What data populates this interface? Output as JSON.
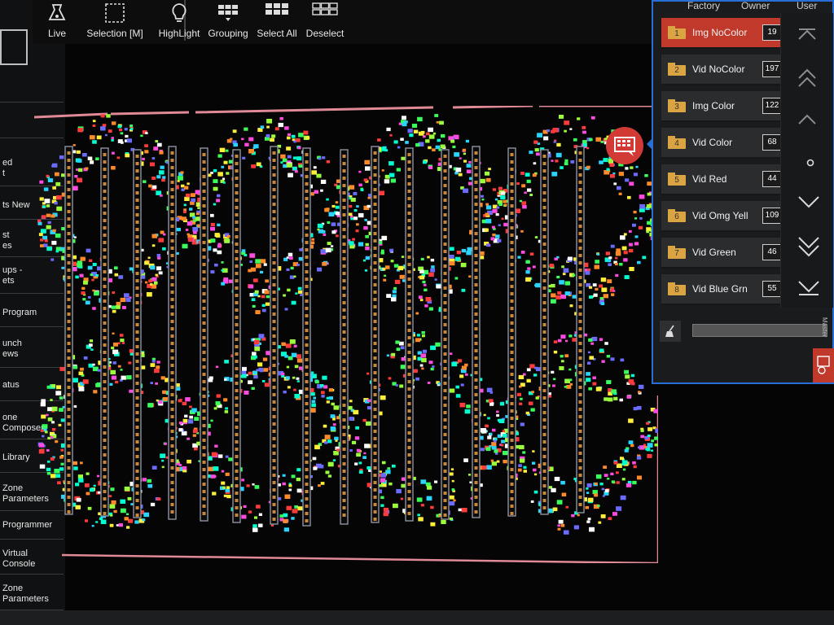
{
  "toolbar": {
    "buttons": [
      {
        "label": "Live",
        "icon": "live-flask-icon"
      },
      {
        "label": "Selection [M]",
        "icon": "selection-box-icon"
      },
      {
        "label": "HighLight",
        "icon": "lightbulb-icon"
      },
      {
        "label": "Grouping",
        "icon": "grouping-grid-icon"
      },
      {
        "label": "Select All",
        "icon": "select-all-grid-icon"
      },
      {
        "label": "Deselect",
        "icon": "deselect-grid-icon"
      }
    ]
  },
  "sidebar": {
    "items": [
      {
        "label": "ed\nt"
      },
      {
        "label": "ts New"
      },
      {
        "label": "st\nes"
      },
      {
        "label": "ups -\nets"
      },
      {
        "label": "Program"
      },
      {
        "label": "unch\news"
      },
      {
        "label": "atus"
      },
      {
        "label": "one\nComposer"
      },
      {
        "label": "Library"
      },
      {
        "label": "Zone\nParameters"
      },
      {
        "label": "Programmer"
      },
      {
        "label": "Virtual\nConsole"
      },
      {
        "label": "Zone\nParameters"
      }
    ]
  },
  "panel": {
    "tabs": [
      "Factory",
      "Owner",
      "User"
    ],
    "presets": [
      {
        "num": "1",
        "name": "Img NoColor",
        "count": "19",
        "selected": true
      },
      {
        "num": "2",
        "name": "Vid NoColor",
        "count": "197",
        "selected": false
      },
      {
        "num": "3",
        "name": "Img Color",
        "count": "122",
        "selected": false
      },
      {
        "num": "4",
        "name": "Vid Color",
        "count": "68",
        "selected": false
      },
      {
        "num": "5",
        "name": "Vid Red",
        "count": "44",
        "selected": false
      },
      {
        "num": "6",
        "name": "Vid Omg Yell",
        "count": "109",
        "selected": false
      },
      {
        "num": "7",
        "name": "Vid Green",
        "count": "46",
        "selected": false
      },
      {
        "num": "8",
        "name": "Vid Blue Grn",
        "count": "55",
        "selected": false
      }
    ],
    "master_label": "Master"
  },
  "colors": {
    "accent_red": "#c0392b",
    "panel_border": "#2a6fd6",
    "folder": "#d9a441",
    "stage_frame": "#e08a97"
  }
}
